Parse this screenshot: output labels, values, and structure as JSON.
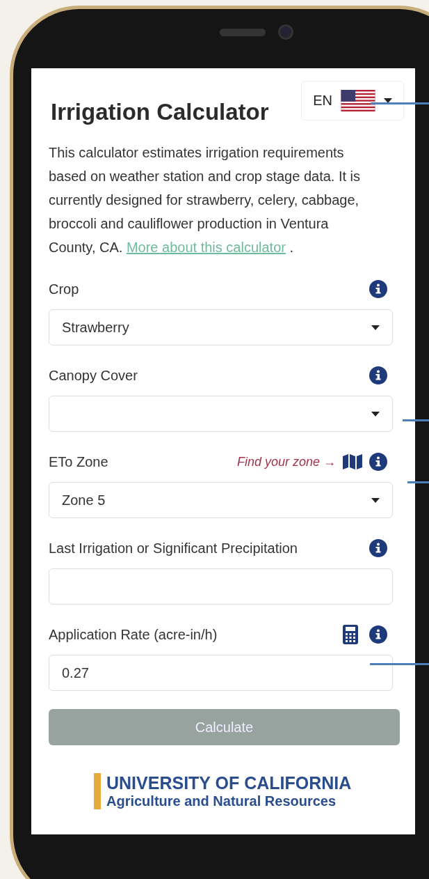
{
  "header": {
    "title": "Irrigation Calculator",
    "language": {
      "code": "EN"
    }
  },
  "intro": {
    "text": "This calculator estimates irrigation requirements based on weather station and crop stage data. It is currently designed for strawberry, celery, cabbage, broccoli and cauliflower production in Ventura County, CA.",
    "link": "More about this calculator",
    "after": "."
  },
  "fields": [
    {
      "label": "Crop",
      "kind": "select",
      "value": "Strawberry",
      "calculator": false
    },
    {
      "label": "Canopy Cover",
      "kind": "select",
      "calculator": false
    },
    {
      "label": "ETo Zone",
      "kind": "select",
      "value": "Zone 5",
      "link": "Find your zone →",
      "calculator": false
    },
    {
      "label": "Last Irrigation or Significant Precipitation",
      "kind": "input",
      "calculator": false
    },
    {
      "label": "Application Rate (acre-in/h)",
      "kind": "input",
      "value": "0.27",
      "calculator": true
    }
  ],
  "calculate_button": {
    "label": "Calculate",
    "disabled": true
  },
  "footer": {
    "logo_line_1": "UNIVERSITY OF CALIFORNIA",
    "logo_line_2": "Agriculture and Natural Resources"
  }
}
